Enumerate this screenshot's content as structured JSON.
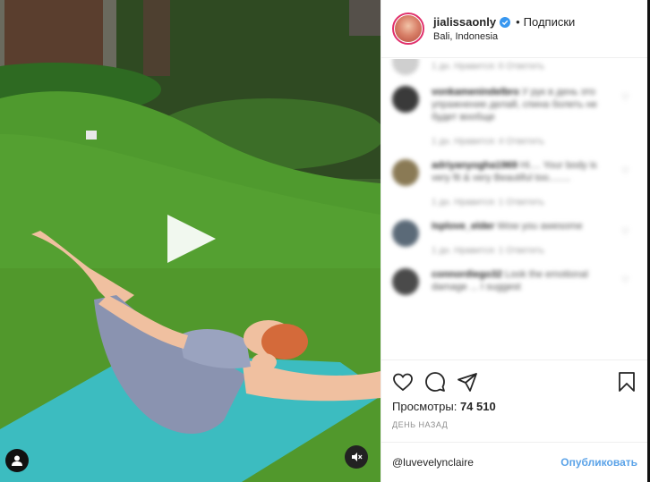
{
  "header": {
    "username": "jialissaonly",
    "separator": "•",
    "follow_label": "Подписки",
    "location": "Bali, Indonesia"
  },
  "comments": [
    {
      "name": "...",
      "text": "",
      "meta": "1 дн.   Нравится: 6   Ответить",
      "avatar_color": "#cfcfcf"
    },
    {
      "name": "vonkamenindelbro",
      "text": "У рук в день это упражнение делай, спина болеть не будет вообще",
      "meta": "1 дн.   Нравится: 4   Ответить",
      "avatar_color": "#3a3a3a"
    },
    {
      "name": "adriyanyogha1969",
      "text": "Hi.... Your body is very fit & very Beautiful too........",
      "meta": "1 дн.   Нравится: 1   Ответить",
      "avatar_color": "#8a7a55"
    },
    {
      "name": "Isplove_elder",
      "text": "Wow you awesome",
      "meta": "1 дн.   Нравится: 1   Ответить",
      "avatar_color": "#5b6a78"
    },
    {
      "name": "connordiego32",
      "text": "Look the emotional damage ... I suggest",
      "meta": "",
      "avatar_color": "#4a4a4a"
    }
  ],
  "actions": {
    "views_label": "Просмотры:",
    "views_count": "74 510",
    "age": "ДЕНЬ НАЗАД"
  },
  "comment_bar": {
    "mention": "@luvevelynclaire",
    "post_label": "Опубликовать"
  },
  "colors": {
    "accent": "#5ba3e8",
    "mat": "#3cbcc0",
    "grass": "#4f8f2a"
  },
  "icons": [
    "play-icon",
    "user-tag-icon",
    "mute-icon",
    "heart-icon",
    "comment-icon",
    "share-icon",
    "bookmark-icon",
    "verified-icon"
  ]
}
